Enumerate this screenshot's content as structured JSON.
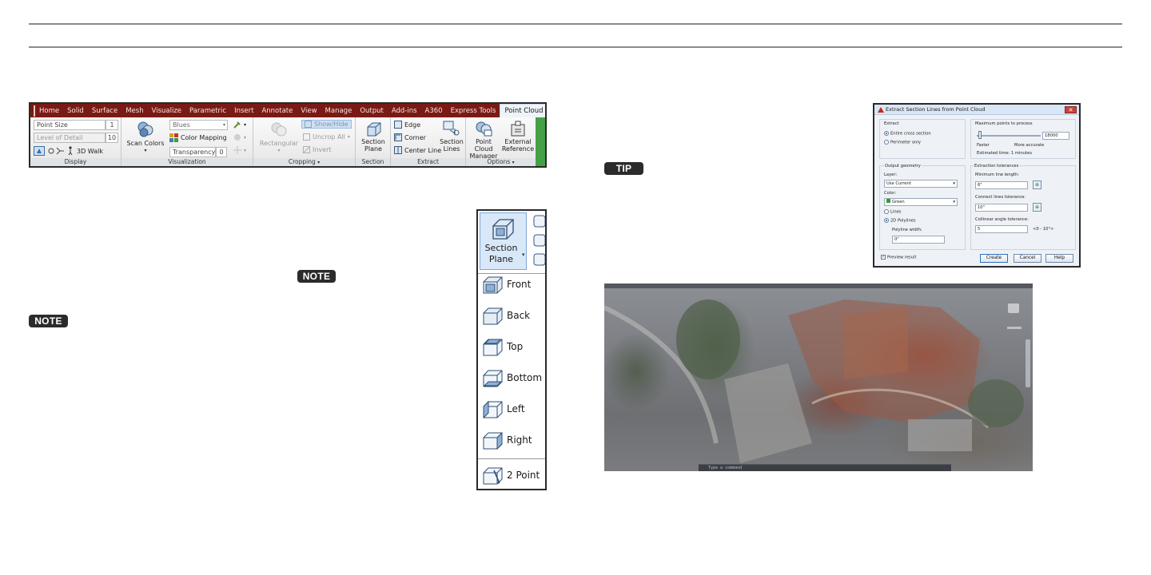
{
  "badges": {
    "tip": "TIP",
    "note_inline": "NOTE",
    "note_left": "NOTE"
  },
  "ribbon": {
    "tabs": [
      "Home",
      "Solid",
      "Surface",
      "Mesh",
      "Visualize",
      "Parametric",
      "Insert",
      "Annotate",
      "View",
      "Manage",
      "Output",
      "Add-ins",
      "A360",
      "Express Tools",
      "Point Cloud"
    ],
    "active_tab": "Point Cloud",
    "display": {
      "title": "Display",
      "point_size_label": "Point Size",
      "point_size_value": "1",
      "level_of_detail_label": "Level of Detail",
      "level_of_detail_value": "10",
      "walk_label": "3D Walk"
    },
    "visualization": {
      "title": "Visualization",
      "scan_colors": "Scan Colors",
      "color_scheme": "Blues",
      "color_mapping": "Color Mapping",
      "transparency_label": "Transparency",
      "transparency_value": "0"
    },
    "cropping": {
      "title": "Cropping",
      "rectangular": "Rectangular",
      "show_hide": "Show/Hide",
      "uncrop_all": "Uncrop All",
      "invert": "Invert"
    },
    "section": {
      "title": "Section",
      "section_plane": "Section Plane"
    },
    "extract": {
      "title": "Extract",
      "edge": "Edge",
      "corner": "Corner",
      "center_line": "Center Line",
      "section_lines": "Section Lines"
    },
    "options": {
      "title": "Options",
      "point_cloud_manager": "Point Cloud Manager",
      "external_reference": "External Reference"
    }
  },
  "section_plane_menu": {
    "button_line1": "Section",
    "button_line2": "Plane",
    "items": [
      "Front",
      "Back",
      "Top",
      "Bottom",
      "Left",
      "Right"
    ],
    "extra_item": "2 Point"
  },
  "dialog": {
    "title": "Extract Section Lines from Point Cloud",
    "extract_label": "Extract",
    "opt_entire": "Entire cross section",
    "opt_perimeter": "Perimeter only",
    "max_points_label": "Maximum points to process",
    "max_points_value": "18000",
    "faster": "Faster",
    "more_accurate": "More accurate",
    "estimated_time": "Estimated time: 1 minutes",
    "output_geometry": "Output geometry",
    "layer_label": "Layer:",
    "layer_value": "Use Current",
    "color_label": "Color:",
    "color_value": "Green",
    "opt_lines": "Lines",
    "opt_2d_polylines": "2D Polylines",
    "polyline_width_label": "Polyline width:",
    "polyline_width_value": "0\"",
    "extraction_tolerances": "Extraction tolerances",
    "min_line_length_label": "Minimum line length:",
    "min_line_length_value": "6\"",
    "connect_lines_label": "Connect lines tolerance:",
    "connect_lines_value": "10\"",
    "collinear_label": "Collinear angle tolerance:",
    "collinear_value": "5",
    "collinear_range": "<0 - 10°>",
    "preview_result": "Preview result",
    "create": "Create",
    "cancel": "Cancel",
    "help": "Help"
  },
  "pointcloud_view": {
    "command_prompt": "Type a command"
  }
}
